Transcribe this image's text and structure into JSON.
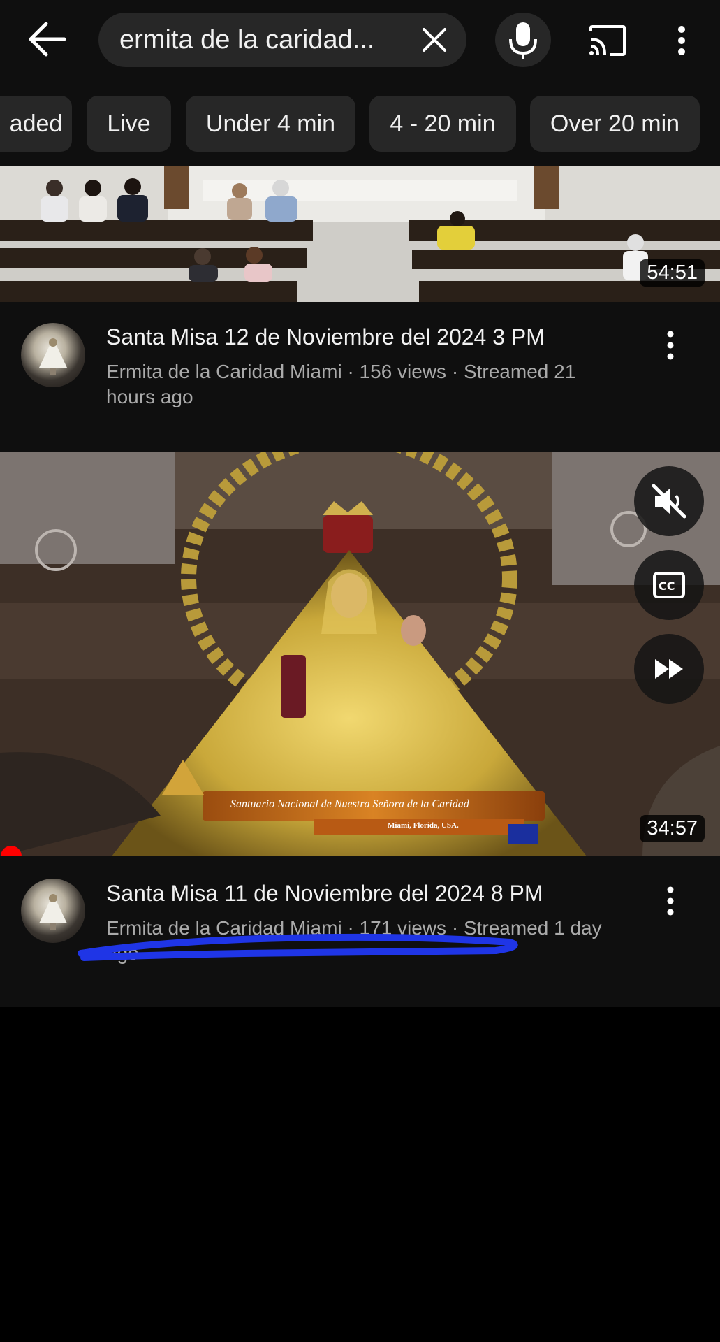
{
  "search": {
    "query": "ermita de la caridad..."
  },
  "filters": [
    {
      "label": "aded"
    },
    {
      "label": "Live"
    },
    {
      "label": "Under 4 min"
    },
    {
      "label": "4 - 20 min"
    },
    {
      "label": "Over 20 min"
    }
  ],
  "videos": [
    {
      "title": "Santa Misa 12 de Noviembre del 2024 3 PM",
      "meta": "Ermita de la Caridad Miami · 156 views · Streamed 21 hours ago",
      "duration": "54:51"
    },
    {
      "title": "Santa Misa 11 de Noviembre del 2024 8 PM",
      "meta": "Ermita de la Caridad Miami · 171 views · Streamed 1 day ago",
      "duration": "34:57",
      "overlay_title": "Santuario Nacional de Nuestra Señora de la Caridad",
      "overlay_subtitle": "Miami, Florida, USA."
    }
  ],
  "colors": {
    "background": "#0f0f0f",
    "chip": "#272727",
    "meta_text": "#aaaaaa",
    "progress_dot": "#ff0000",
    "scribble": "#1f35e6"
  }
}
